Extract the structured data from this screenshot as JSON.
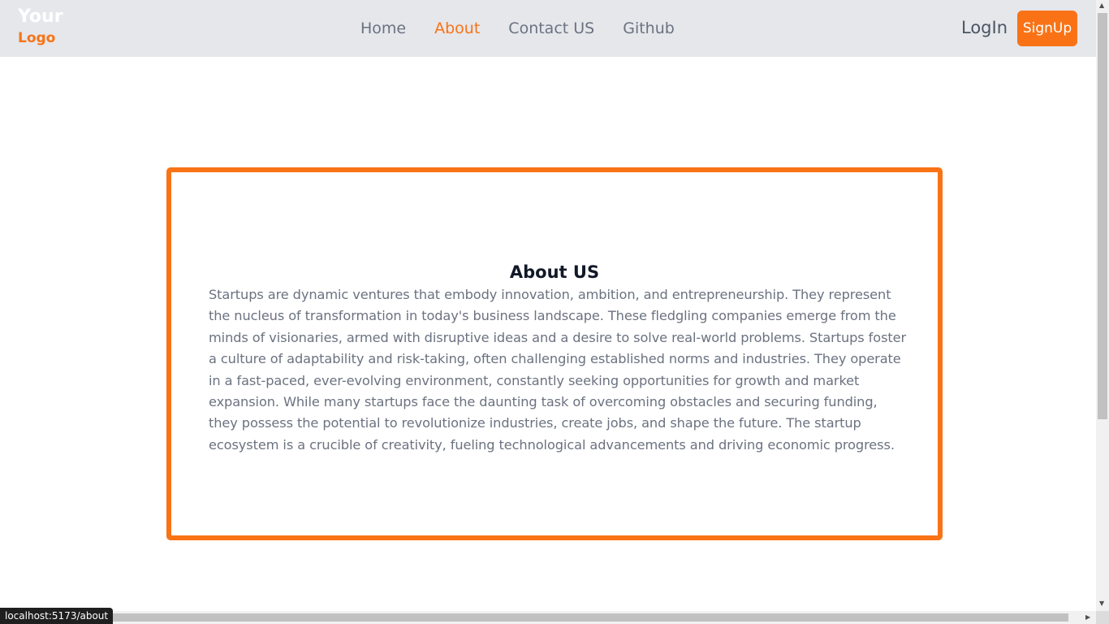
{
  "logo": {
    "line1": "Your",
    "line2": "Logo"
  },
  "nav": {
    "items": [
      {
        "label": "Home"
      },
      {
        "label": "About"
      },
      {
        "label": "Contact US"
      },
      {
        "label": "Github"
      }
    ],
    "active": "About"
  },
  "auth": {
    "login_label": "LogIn",
    "signup_label": "SignUp"
  },
  "about": {
    "title": "About US",
    "body": "Startups are dynamic ventures that embody innovation, ambition, and entrepreneurship. They represent the nucleus of transformation in today's business landscape. These fledgling companies emerge from the minds of visionaries, armed with disruptive ideas and a desire to solve real-world problems. Startups foster a culture of adaptability and risk-taking, often challenging established norms and industries. They operate in a fast-paced, ever-evolving environment, constantly seeking opportunities for growth and market expansion. While many startups face the daunting task of overcoming obstacles and securing funding, they possess the potential to revolutionize industries, create jobs, and shape the future. The startup ecosystem is a crucible of creativity, fueling technological advancements and driving economic progress."
  },
  "status_bar": {
    "url": "localhost:5173/about"
  },
  "colors": {
    "accent": "#f97316",
    "navbar_bg": "#e5e7eb",
    "nav_text": "#6b7280",
    "title_text": "#111827"
  }
}
